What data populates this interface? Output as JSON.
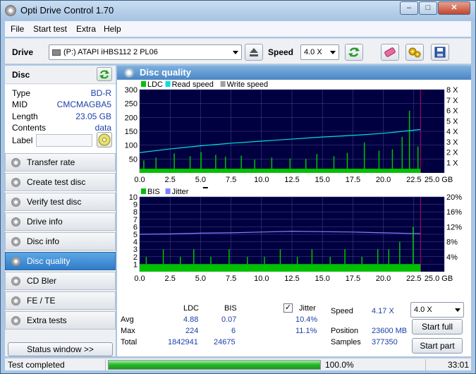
{
  "window": {
    "title": "Opti Drive Control 1.70",
    "controls": [
      "–",
      "□",
      "✕"
    ]
  },
  "menu": [
    "File",
    "Start test",
    "Extra",
    "Help"
  ],
  "toolbar": {
    "drive_label": "Drive",
    "drive_value": "(P:)   ATAPI iHBS112   2 PL06",
    "speed_label": "Speed",
    "speed_value": "4.0 X"
  },
  "disc": {
    "header": "Disc",
    "rows": [
      {
        "key": "Type",
        "value": "BD-R"
      },
      {
        "key": "MID",
        "value": "CMCMAGBA5"
      },
      {
        "key": "Length",
        "value": "23.05 GB"
      },
      {
        "key": "Contents",
        "value": "data"
      }
    ],
    "label_key": "Label",
    "label_value": ""
  },
  "nav": [
    {
      "label": "Transfer rate",
      "active": false
    },
    {
      "label": "Create test disc",
      "active": false
    },
    {
      "label": "Verify test disc",
      "active": false
    },
    {
      "label": "Drive info",
      "active": false
    },
    {
      "label": "Disc info",
      "active": false
    },
    {
      "label": "Disc quality",
      "active": true
    },
    {
      "label": "CD Bler",
      "active": false
    },
    {
      "label": "FE / TE",
      "active": false
    },
    {
      "label": "Extra tests",
      "active": false
    }
  ],
  "status_window_btn": "Status window >>",
  "panel_title": "Disc quality",
  "chart_data": [
    {
      "type": "area",
      "legend": [
        "LDC",
        "Read speed",
        "Write speed"
      ],
      "colors": {
        "LDC": "#00c000",
        "Read speed": "#00e0e0",
        "Write speed": "#a0a0a0"
      },
      "x_ticks": [
        "0.0",
        "2.5",
        "5.0",
        "7.5",
        "10.0",
        "12.5",
        "15.0",
        "17.5",
        "20.0",
        "22.5",
        "25.0 GB"
      ],
      "y_left_ticks": [
        "50",
        "100",
        "150",
        "200",
        "250",
        "300"
      ],
      "y_right_ticks": [
        "1 X",
        "2 X",
        "3 X",
        "4 X",
        "5 X",
        "6 X",
        "7 X",
        "8 X"
      ],
      "xlim": [
        0,
        25
      ],
      "ylim": [
        0,
        300
      ],
      "y_right_lim": [
        0,
        8
      ],
      "disc_end": 23.05,
      "read_speed": {
        "x": [
          0,
          2.5,
          5,
          7.5,
          10,
          12.5,
          15,
          17.5,
          20,
          22.5,
          23.05
        ],
        "y": [
          1.95,
          2.3,
          2.6,
          2.85,
          3.05,
          3.25,
          3.45,
          3.6,
          3.8,
          4.1,
          4.17
        ]
      },
      "ldc_baseline": 15,
      "ldc_spikes": {
        "x": [
          0.3,
          1.3,
          2.8,
          4.1,
          5.0,
          6.2,
          7.0,
          8.3,
          9.4,
          10.8,
          12.3,
          13.6,
          14.5,
          15.9,
          17.0,
          18.4,
          19.6,
          20.7,
          21.5,
          22.1,
          22.8
        ],
        "y": [
          45,
          55,
          70,
          60,
          75,
          65,
          58,
          62,
          48,
          55,
          52,
          50,
          68,
          60,
          72,
          110,
          80,
          85,
          130,
          224,
          95
        ]
      }
    },
    {
      "type": "area",
      "legend": [
        "BIS",
        "Jitter"
      ],
      "colors": {
        "BIS": "#00c000",
        "Jitter": "#8080ff"
      },
      "x_ticks": [
        "0.0",
        "2.5",
        "5.0",
        "7.5",
        "10.0",
        "12.5",
        "15.0",
        "17.5",
        "20.0",
        "22.5",
        "25.0 GB"
      ],
      "y_left_ticks": [
        "1",
        "2",
        "3",
        "4",
        "5",
        "6",
        "7",
        "8",
        "9",
        "10"
      ],
      "y_right_ticks": [
        "4%",
        "8%",
        "12%",
        "16%",
        "20%"
      ],
      "xlim": [
        0,
        25
      ],
      "ylim": [
        0,
        10
      ],
      "y_right_lim": [
        0,
        20
      ],
      "disc_end": 23.05,
      "bis_baseline": 1,
      "bis_spikes": {
        "x": [
          0.5,
          1.9,
          3.3,
          4.4,
          5.8,
          7.3,
          8.8,
          10.2,
          11.5,
          12.9,
          14.1,
          15.6,
          16.8,
          18.2,
          19.5,
          20.4,
          21.3,
          22.4
        ],
        "y": [
          2,
          3,
          2,
          3,
          2,
          3,
          2,
          2,
          3,
          2,
          3,
          2,
          3,
          2,
          3,
          3,
          4,
          6
        ]
      },
      "jitter": {
        "x": [
          0,
          2.5,
          5,
          7.5,
          10,
          12.5,
          15,
          17.5,
          20,
          22.5,
          23.05
        ],
        "y": [
          10.0,
          10.1,
          10.3,
          10.4,
          10.6,
          10.8,
          10.7,
          10.6,
          10.4,
          10.2,
          10.2
        ]
      }
    }
  ],
  "stats": {
    "headers": [
      "LDC",
      "BIS"
    ],
    "jitter_label": "Jitter",
    "jitter_checked": true,
    "rows": [
      {
        "label": "Avg",
        "ldc": "4.88",
        "bis": "0.07",
        "jitter": "10.4%"
      },
      {
        "label": "Max",
        "ldc": "224",
        "bis": "6",
        "jitter": "11.1%"
      },
      {
        "label": "Total",
        "ldc": "1842941",
        "bis": "24675",
        "jitter": ""
      }
    ],
    "speed_label": "Speed",
    "speed_value": "4.17 X",
    "position_label": "Position",
    "position_value": "23600 MB",
    "samples_label": "Samples",
    "samples_value": "377350",
    "speed_select": "4.0 X",
    "start_full": "Start full",
    "start_part": "Start part"
  },
  "statusbar": {
    "text": "Test completed",
    "progress": 1.0,
    "percent": "100.0%",
    "time": "33:01"
  }
}
